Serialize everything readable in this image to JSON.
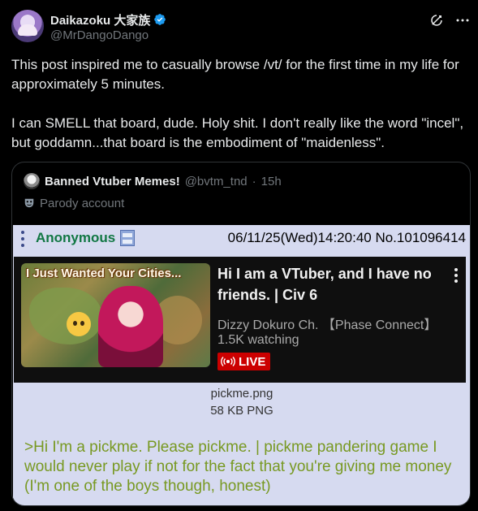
{
  "author": {
    "display_name": "Daikazoku 大家族",
    "handle": "@MrDangoDango",
    "verified": true,
    "avatar_icon": "vtuber-avatar-icon"
  },
  "header_icons": [
    "grok-icon",
    "more-options-icon"
  ],
  "post": {
    "text": "This post inspired me to casually browse /vt/ for the first time in my life for approximately 5 minutes.\n\nI can SMELL that board, dude. Holy shit. I don't really like the word \"incel\", but goddamn...that board is the embodiment of \"maidenless\"."
  },
  "quoted_post": {
    "display_name": "Banned Vtuber Memes!",
    "handle": "@bvtm_tnd",
    "separator": "·",
    "time": "15h",
    "parody_label": "Parody account",
    "chan_post": {
      "name": "Anonymous",
      "meta": "06/11/25(Wed)14:20:40 No.101096414",
      "youtube": {
        "thumbnail_caption": "I Just Wanted Your Cities...",
        "title": "Hi I am a VTuber, and I have no friends. | Civ 6",
        "channel": "Dizzy Dokuro Ch. 【Phase Connect】",
        "watching": "1.5K watching",
        "live_label": "LIVE"
      },
      "file_name": "pickme.png",
      "file_size": "58 KB PNG",
      "greentext": ">Hi I'm a pickme. Please pickme. | pickme pandering game I would never play if not for the fact that you're giving me money (I'm one of the boys though, honest)"
    }
  },
  "colors": {
    "background": "#000000",
    "text": "#e7e9ea",
    "muted": "#71767b",
    "verified_blue": "#1d9bf0",
    "chan_bg": "#d6daf0",
    "anon_green": "#117743",
    "greentext": "#789922",
    "live_red": "#cc0000"
  }
}
